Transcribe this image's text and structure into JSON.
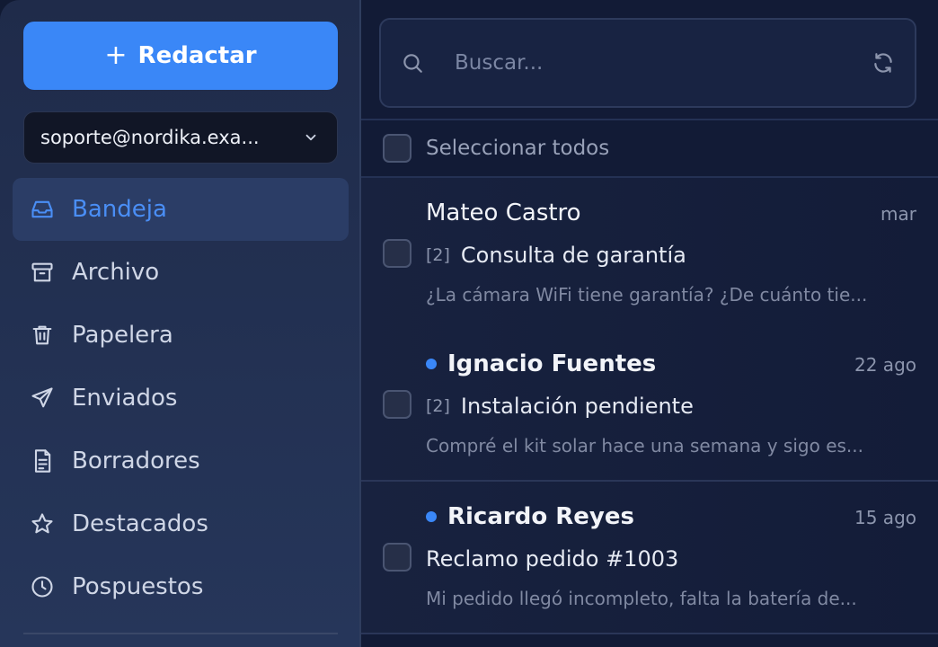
{
  "sidebar": {
    "compose_label": "Redactar",
    "account": "soporte@nordika.exa...",
    "items": [
      {
        "label": "Bandeja",
        "icon": "inbox-icon",
        "active": true
      },
      {
        "label": "Archivo",
        "icon": "archive-icon"
      },
      {
        "label": "Papelera",
        "icon": "trash-icon"
      },
      {
        "label": "Enviados",
        "icon": "send-icon"
      },
      {
        "label": "Borradores",
        "icon": "draft-icon"
      },
      {
        "label": "Destacados",
        "icon": "star-icon"
      },
      {
        "label": "Pospuestos",
        "icon": "clock-icon"
      }
    ]
  },
  "search": {
    "placeholder": "Buscar..."
  },
  "list": {
    "select_all_label": "Seleccionar todos",
    "messages": [
      {
        "sender": "Mateo Castro",
        "unread": false,
        "date": "mar",
        "count": "[2]",
        "subject": "Consulta de garantía",
        "preview": "¿La cámara WiFi tiene garantía? ¿De cuánto tie..."
      },
      {
        "sender": "Ignacio Fuentes",
        "unread": true,
        "date": "22 ago",
        "count": "[2]",
        "subject": "Instalación pendiente",
        "preview": "Compré el kit solar hace una semana y sigo es..."
      },
      {
        "sender": "Ricardo Reyes",
        "unread": true,
        "date": "15 ago",
        "count": "",
        "subject": "Reclamo pedido #1003",
        "preview": "Mi pedido llegó incompleto, falta la batería de..."
      }
    ]
  },
  "colors": {
    "accent": "#3a87f7",
    "sidebar_bg": "#1f2b4a",
    "main_bg": "#121b36"
  }
}
